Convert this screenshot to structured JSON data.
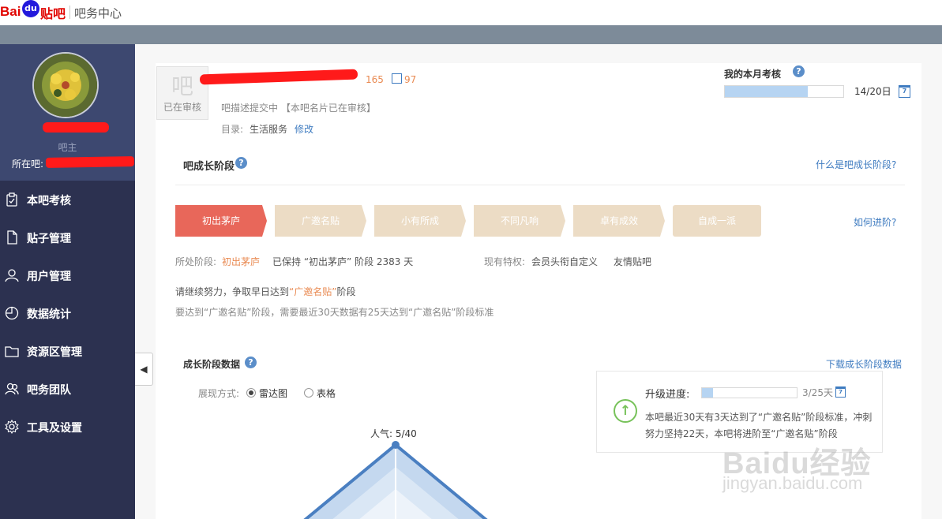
{
  "header": {
    "logo_bai": "Bai",
    "logo_du": "du",
    "logo_tieba": "贴吧",
    "center_title": "吧务中心"
  },
  "sidebar": {
    "role": "吧主",
    "current_bar_label": "所在吧:",
    "collapse_icon": "◀",
    "items": [
      {
        "label": "本吧考核",
        "icon": "clipboard-icon"
      },
      {
        "label": "贴子管理",
        "icon": "document-icon"
      },
      {
        "label": "用户管理",
        "icon": "user-icon"
      },
      {
        "label": "数据统计",
        "icon": "chart-icon"
      },
      {
        "label": "资源区管理",
        "icon": "folder-icon"
      },
      {
        "label": "吧务团队",
        "icon": "team-icon"
      },
      {
        "label": "工具及设置",
        "icon": "gear-icon"
      }
    ]
  },
  "bar_info": {
    "logo_char": "吧",
    "logo_status": "已在审核",
    "members": "165",
    "posts": "97",
    "desc_status": "吧描述提交中 【本吧名片已在审核】",
    "dir_label": "目录:",
    "dir_value": "生活服务",
    "dir_edit": "修改"
  },
  "exam": {
    "title": "我的本月考核",
    "help": "?",
    "progress": 0.7,
    "value_text": "14/20日",
    "calendar_label": "7"
  },
  "growth": {
    "title": "吧成长阶段",
    "help": "?",
    "what_link": "什么是吧成长阶段?",
    "stages": [
      "初出茅庐",
      "广邀名贴",
      "小有所成",
      "不同凡响",
      "卓有成效",
      "自成一派"
    ],
    "current_stage_index": 0,
    "how_advance": "如何进阶?",
    "stage_label": "所处阶段:",
    "stage_current": "初出茅庐",
    "stage_kept": "已保持 “初出茅庐” 阶段 2383 天",
    "priv_label": "现有特权:",
    "privileges": [
      "会员头衔自定义",
      "友情贴吧"
    ],
    "encourage": "请继续努力，争取早日达到“广邀名贴”阶段",
    "requirement": "要达到“广邀名贴”阶段，需要最近30天数据有25天达到“广邀名贴”阶段标准"
  },
  "growth_data": {
    "title": "成长阶段数据",
    "help": "?",
    "download": "下载成长阶段数据",
    "display_label": "展现方式:",
    "options": [
      "雷达图",
      "表格"
    ],
    "selected": "雷达图",
    "radar_label": "人气: 5/40"
  },
  "upgrade": {
    "label": "升级进度:",
    "progress": 0.12,
    "value_text": "3/25天",
    "calendar_label": "7",
    "icon": "arrow-up-circle-icon",
    "text": "本吧最近30天有3天达到了“广邀名贴”阶段标准，冲刺努力坚持22天，本吧将进阶至“广邀名贴”阶段"
  },
  "watermark": {
    "main": "Baidu经验",
    "sub": "jingyan.baidu.com"
  },
  "colors": {
    "sidebar_bg": "#2c3150",
    "sidebar_head": "#3d4870",
    "active_stage": "#e8675a",
    "inactive_stage": "#ecdcc5",
    "link": "#3e7bc0",
    "accent_orange": "#e98a52"
  }
}
